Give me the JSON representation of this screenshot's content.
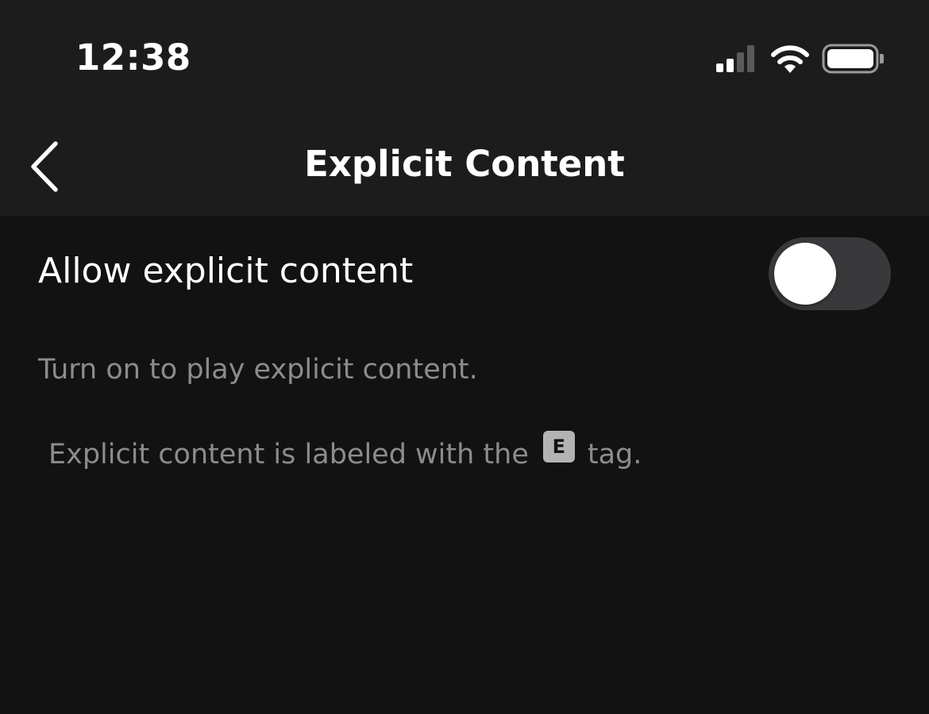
{
  "status_bar": {
    "time": "12:38",
    "icons": [
      "cellular-signal-icon",
      "wifi-icon",
      "battery-icon"
    ]
  },
  "nav": {
    "back_icon": "chevron-left-icon",
    "title": "Explicit Content"
  },
  "setting": {
    "label": "Allow explicit content",
    "toggle_state": "off"
  },
  "description": {
    "line1": "Turn on to play explicit content.",
    "line2_prefix": "Explicit content is labeled with the",
    "tag_letter": "E",
    "line2_suffix": "tag."
  },
  "colors": {
    "background": "#121212",
    "header_background": "#1c1c1c",
    "toggle_off_track": "#39393c",
    "secondary_text": "#8c8c8c",
    "tag_background": "#b3b3b3"
  }
}
